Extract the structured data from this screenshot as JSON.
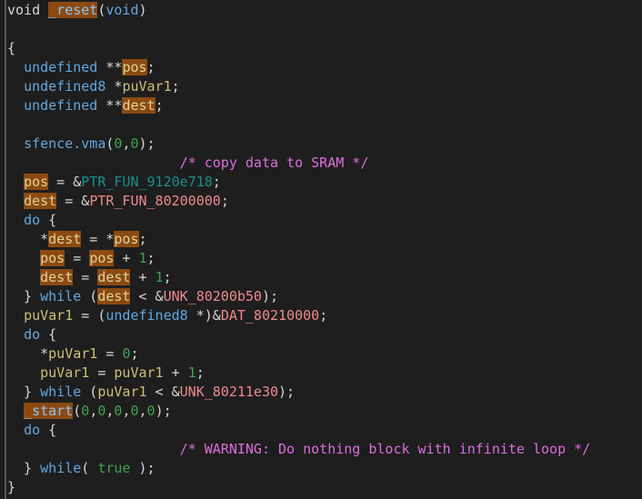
{
  "panel": {
    "name": "ghidra-decompiler",
    "background": "#1e1e1e",
    "gutter_color": "#5a5a5a"
  },
  "colors": {
    "plain": "#d6d6d6",
    "type": "#63a8e0",
    "keyword": "#63a8e0",
    "variable": "#c9c177",
    "comment": "#dd6edd",
    "number": "#3fa34f",
    "data_symbol": "#ef8a8a",
    "pointer_symbol": "#15908f",
    "highlight_bg": "#8c4a11",
    "highlight_var_fg": "#ddd39a",
    "highlight_func_fg": "#8fc4ef"
  },
  "code": {
    "function_name": "_reset",
    "lines": [
      {
        "n": 1,
        "tokens": [
          {
            "t": "void",
            "c": "plain"
          },
          {
            "t": " ",
            "c": "plain"
          },
          {
            "t": "_reset",
            "c": "funcname",
            "hl": true
          },
          {
            "t": "(",
            "c": "punct"
          },
          {
            "t": "void",
            "c": "type"
          },
          {
            "t": ")",
            "c": "punct"
          }
        ]
      },
      {
        "n": 2,
        "tokens": []
      },
      {
        "n": 3,
        "tokens": [
          {
            "t": "{",
            "c": "punct"
          }
        ]
      },
      {
        "n": 4,
        "tokens": [
          {
            "t": "  ",
            "c": "plain"
          },
          {
            "t": "undefined",
            "c": "type"
          },
          {
            "t": " **",
            "c": "punct"
          },
          {
            "t": "pos",
            "c": "var",
            "hl": true
          },
          {
            "t": ";",
            "c": "punct"
          }
        ]
      },
      {
        "n": 5,
        "tokens": [
          {
            "t": "  ",
            "c": "plain"
          },
          {
            "t": "undefined8",
            "c": "type"
          },
          {
            "t": " *",
            "c": "punct"
          },
          {
            "t": "puVar1",
            "c": "var"
          },
          {
            "t": ";",
            "c": "punct"
          }
        ]
      },
      {
        "n": 6,
        "tokens": [
          {
            "t": "  ",
            "c": "plain"
          },
          {
            "t": "undefined",
            "c": "type"
          },
          {
            "t": " **",
            "c": "punct"
          },
          {
            "t": "dest",
            "c": "var",
            "hl": true
          },
          {
            "t": ";",
            "c": "punct"
          }
        ]
      },
      {
        "n": 7,
        "tokens": []
      },
      {
        "n": 8,
        "tokens": [
          {
            "t": "  ",
            "c": "plain"
          },
          {
            "t": "sfence.vma",
            "c": "keyword"
          },
          {
            "t": "(",
            "c": "punct"
          },
          {
            "t": "0",
            "c": "number"
          },
          {
            "t": ",",
            "c": "punct"
          },
          {
            "t": "0",
            "c": "number"
          },
          {
            "t": ");",
            "c": "punct"
          }
        ]
      },
      {
        "n": 9,
        "tokens": [
          {
            "t": "                     ",
            "c": "plain"
          },
          {
            "t": "/* copy data to SRAM */",
            "c": "comment"
          }
        ]
      },
      {
        "n": 10,
        "tokens": [
          {
            "t": "  ",
            "c": "plain"
          },
          {
            "t": "pos",
            "c": "var",
            "hl": true
          },
          {
            "t": " = &",
            "c": "punct"
          },
          {
            "t": "PTR_FUN_9120e718",
            "c": "ptrsym"
          },
          {
            "t": ";",
            "c": "punct"
          }
        ]
      },
      {
        "n": 11,
        "tokens": [
          {
            "t": "  ",
            "c": "plain"
          },
          {
            "t": "dest",
            "c": "var",
            "hl": true
          },
          {
            "t": " = &",
            "c": "punct"
          },
          {
            "t": "PTR_FUN_80200000",
            "c": "datasym"
          },
          {
            "t": ";",
            "c": "punct"
          }
        ]
      },
      {
        "n": 12,
        "tokens": [
          {
            "t": "  ",
            "c": "plain"
          },
          {
            "t": "do",
            "c": "keyword"
          },
          {
            "t": " {",
            "c": "punct"
          }
        ]
      },
      {
        "n": 13,
        "tokens": [
          {
            "t": "    *",
            "c": "punct"
          },
          {
            "t": "dest",
            "c": "var",
            "hl": true
          },
          {
            "t": " = *",
            "c": "punct"
          },
          {
            "t": "pos",
            "c": "var",
            "hl": true
          },
          {
            "t": ";",
            "c": "punct"
          }
        ]
      },
      {
        "n": 14,
        "tokens": [
          {
            "t": "    ",
            "c": "plain"
          },
          {
            "t": "pos",
            "c": "var",
            "hl": true
          },
          {
            "t": " = ",
            "c": "punct"
          },
          {
            "t": "pos",
            "c": "var",
            "hl": true
          },
          {
            "t": " + ",
            "c": "punct"
          },
          {
            "t": "1",
            "c": "number"
          },
          {
            "t": ";",
            "c": "punct"
          }
        ]
      },
      {
        "n": 15,
        "tokens": [
          {
            "t": "    ",
            "c": "plain"
          },
          {
            "t": "dest",
            "c": "var",
            "hl": true
          },
          {
            "t": " = ",
            "c": "punct"
          },
          {
            "t": "dest",
            "c": "var",
            "hl": true
          },
          {
            "t": " + ",
            "c": "punct"
          },
          {
            "t": "1",
            "c": "number"
          },
          {
            "t": ";",
            "c": "punct"
          }
        ]
      },
      {
        "n": 16,
        "tokens": [
          {
            "t": "  } ",
            "c": "punct"
          },
          {
            "t": "while",
            "c": "keyword"
          },
          {
            "t": " (",
            "c": "punct"
          },
          {
            "t": "dest",
            "c": "var",
            "hl": true
          },
          {
            "t": " < &",
            "c": "punct"
          },
          {
            "t": "UNK_80200b50",
            "c": "datasym"
          },
          {
            "t": ");",
            "c": "punct"
          }
        ]
      },
      {
        "n": 17,
        "tokens": [
          {
            "t": "  ",
            "c": "plain"
          },
          {
            "t": "puVar1",
            "c": "var"
          },
          {
            "t": " = (",
            "c": "punct"
          },
          {
            "t": "undefined8",
            "c": "type"
          },
          {
            "t": " *)&",
            "c": "punct"
          },
          {
            "t": "DAT_80210000",
            "c": "datasym"
          },
          {
            "t": ";",
            "c": "punct"
          }
        ]
      },
      {
        "n": 18,
        "tokens": [
          {
            "t": "  ",
            "c": "plain"
          },
          {
            "t": "do",
            "c": "keyword"
          },
          {
            "t": " {",
            "c": "punct"
          }
        ]
      },
      {
        "n": 19,
        "tokens": [
          {
            "t": "    *",
            "c": "punct"
          },
          {
            "t": "puVar1",
            "c": "var"
          },
          {
            "t": " = ",
            "c": "punct"
          },
          {
            "t": "0",
            "c": "number"
          },
          {
            "t": ";",
            "c": "punct"
          }
        ]
      },
      {
        "n": 20,
        "tokens": [
          {
            "t": "    ",
            "c": "plain"
          },
          {
            "t": "puVar1",
            "c": "var"
          },
          {
            "t": " = ",
            "c": "punct"
          },
          {
            "t": "puVar1",
            "c": "var"
          },
          {
            "t": " + ",
            "c": "punct"
          },
          {
            "t": "1",
            "c": "number"
          },
          {
            "t": ";",
            "c": "punct"
          }
        ]
      },
      {
        "n": 21,
        "tokens": [
          {
            "t": "  } ",
            "c": "punct"
          },
          {
            "t": "while",
            "c": "keyword"
          },
          {
            "t": " (",
            "c": "punct"
          },
          {
            "t": "puVar1",
            "c": "var"
          },
          {
            "t": " < &",
            "c": "punct"
          },
          {
            "t": "UNK_80211e30",
            "c": "datasym"
          },
          {
            "t": ");",
            "c": "punct"
          }
        ]
      },
      {
        "n": 22,
        "tokens": [
          {
            "t": "  ",
            "c": "plain"
          },
          {
            "t": "_start",
            "c": "funcname",
            "hl": true
          },
          {
            "t": "(",
            "c": "punct"
          },
          {
            "t": "0",
            "c": "number"
          },
          {
            "t": ",",
            "c": "punct"
          },
          {
            "t": "0",
            "c": "number"
          },
          {
            "t": ",",
            "c": "punct"
          },
          {
            "t": "0",
            "c": "number"
          },
          {
            "t": ",",
            "c": "punct"
          },
          {
            "t": "0",
            "c": "number"
          },
          {
            "t": ",",
            "c": "punct"
          },
          {
            "t": "0",
            "c": "number"
          },
          {
            "t": ");",
            "c": "punct"
          }
        ]
      },
      {
        "n": 23,
        "tokens": [
          {
            "t": "  ",
            "c": "plain"
          },
          {
            "t": "do",
            "c": "keyword"
          },
          {
            "t": " {",
            "c": "punct"
          }
        ]
      },
      {
        "n": 24,
        "tokens": [
          {
            "t": "                     ",
            "c": "plain"
          },
          {
            "t": "/* WARNING: Do nothing block with infinite loop */",
            "c": "comment"
          }
        ]
      },
      {
        "n": 25,
        "tokens": [
          {
            "t": "  } ",
            "c": "punct"
          },
          {
            "t": "while",
            "c": "keyword"
          },
          {
            "t": "( ",
            "c": "punct"
          },
          {
            "t": "true",
            "c": "const"
          },
          {
            "t": " );",
            "c": "punct"
          }
        ]
      },
      {
        "n": 26,
        "tokens": [
          {
            "t": "}",
            "c": "punct"
          }
        ]
      }
    ]
  }
}
